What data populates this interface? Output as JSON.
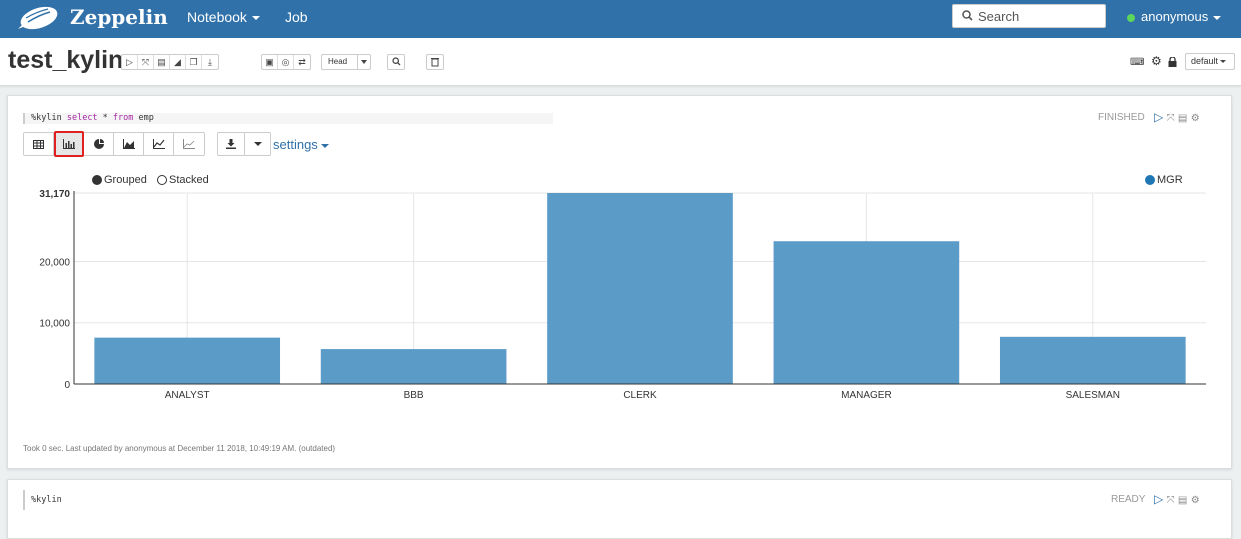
{
  "navbar": {
    "brand": "Zeppelin",
    "notebook_label": "Notebook",
    "job_label": "Job",
    "search_placeholder": "Search",
    "user": "anonymous"
  },
  "note": {
    "title": "test_kylin",
    "head_select": "Head",
    "interpreter_select": "default"
  },
  "paragraph1": {
    "code_prefix": "%kylin",
    "code_kw1": "select",
    "code_mid": " * ",
    "code_kw2": "from",
    "code_suffix": " emp",
    "status": "FINISHED",
    "settings_label": "settings",
    "legend_grouped": "Grouped",
    "legend_stacked": "Stacked",
    "legend_series": "MGR",
    "footer": "Took 0 sec. Last updated by anonymous at December 11 2018, 10:49:19 AM. (outdated)"
  },
  "paragraph2": {
    "code": "%kylin",
    "status": "READY"
  },
  "colors": {
    "navbar": "#3071a9",
    "bar": "#5b9bc8",
    "series": "#1f77b4",
    "active_highlight": "#e02020"
  },
  "chart_data": {
    "type": "bar",
    "categories": [
      "ANALYST",
      "BBB",
      "CLERK",
      "MANAGER",
      "SALESMAN"
    ],
    "series": [
      {
        "name": "MGR",
        "values": [
          7566,
          5700,
          31170,
          23300,
          7698
        ]
      }
    ],
    "yticks": [
      "0",
      "10,000",
      "20,000",
      "31,170"
    ],
    "ylim": [
      0,
      31170
    ],
    "grid": true,
    "legend": "top-right"
  }
}
